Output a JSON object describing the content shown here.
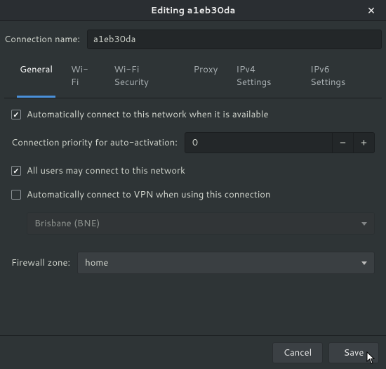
{
  "window": {
    "title": "Editing a1eb30da"
  },
  "connection": {
    "label": "Connection name:",
    "value": "a1eb30da"
  },
  "tabs": {
    "general": "General",
    "wifi": "Wi-Fi",
    "wifisec": "Wi-Fi Security",
    "proxy": "Proxy",
    "ipv4": "IPv4 Settings",
    "ipv6": "IPv6 Settings"
  },
  "general": {
    "autoconnect": "Automatically connect to this network when it is available",
    "priority_label": "Connection priority for auto-activation:",
    "priority_value": "0",
    "allusers": "All users may connect to this network",
    "autovpn": "Automatically connect to VPN when using this connection",
    "vpn_value": "Brisbane (BNE)",
    "fwzone_label": "Firewall zone:",
    "fwzone_value": "home"
  },
  "footer": {
    "cancel": "Cancel",
    "save": "Save"
  }
}
